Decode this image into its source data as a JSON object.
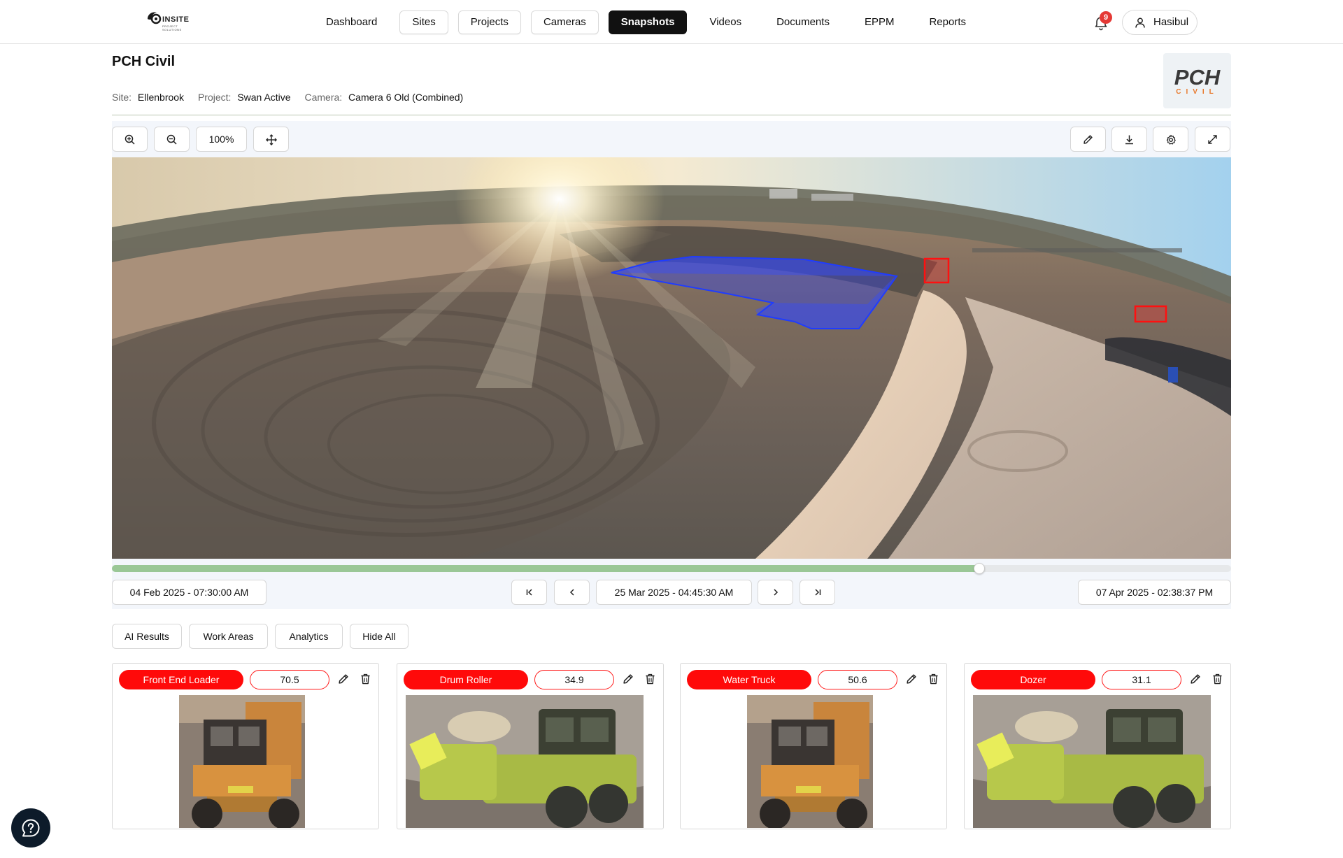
{
  "nav": {
    "logo_text": "INSITE",
    "logo_sub_1": "PROJECT",
    "logo_sub_2": "SOLUTIONS",
    "items": [
      {
        "label": "Dashboard",
        "boxed": false,
        "active": false
      },
      {
        "label": "Sites",
        "boxed": true,
        "active": false
      },
      {
        "label": "Projects",
        "boxed": true,
        "active": false
      },
      {
        "label": "Cameras",
        "boxed": true,
        "active": false
      },
      {
        "label": "Snapshots",
        "boxed": false,
        "active": true
      },
      {
        "label": "Videos",
        "boxed": false,
        "active": false
      },
      {
        "label": "Documents",
        "boxed": false,
        "active": false
      },
      {
        "label": "EPPM",
        "boxed": false,
        "active": false
      },
      {
        "label": "Reports",
        "boxed": false,
        "active": false
      }
    ],
    "notifications_count": "9",
    "user_name": "Hasibul"
  },
  "header": {
    "title": "PCH Civil",
    "site_label": "Site:",
    "site_value": "Ellenbrook",
    "project_label": "Project:",
    "project_value": "Swan Active",
    "camera_label": "Camera:",
    "camera_value": "Camera 6 Old (Combined)",
    "brand_logo_top": "PCH",
    "brand_logo_bottom": "CIVIL"
  },
  "viewer": {
    "zoom_level": "100%",
    "timeline_progress": 0.775,
    "start_date": "04 Feb 2025 - 07:30:00 AM",
    "current_date": "25 Mar 2025 - 04:45:30 AM",
    "end_date": "07 Apr 2025 - 02:38:37 PM"
  },
  "tabs": [
    "AI Results",
    "Work Areas",
    "Analytics",
    "Hide All"
  ],
  "detections": [
    {
      "label": "Front End Loader",
      "score": "70.5",
      "thumb": "truck"
    },
    {
      "label": "Drum Roller",
      "score": "34.9",
      "thumb": "roller"
    },
    {
      "label": "Water Truck",
      "score": "50.6",
      "thumb": "truck"
    },
    {
      "label": "Dozer",
      "score": "31.1",
      "thumb": "roller"
    }
  ],
  "colors": {
    "accent_active": "#111111",
    "detection_red": "#ff0a0a",
    "work_area_blue": "#1f3cff",
    "timeline_green": "#9ac796",
    "brand_orange": "#e8782a"
  },
  "icons": {
    "zoom_in": "zoom-in-icon",
    "zoom_out": "zoom-out-icon",
    "pan": "move-icon",
    "edit": "pencil-icon",
    "download": "download-icon",
    "settings": "gear-icon",
    "fullscreen": "expand-icon",
    "help": "help-chat-icon"
  }
}
